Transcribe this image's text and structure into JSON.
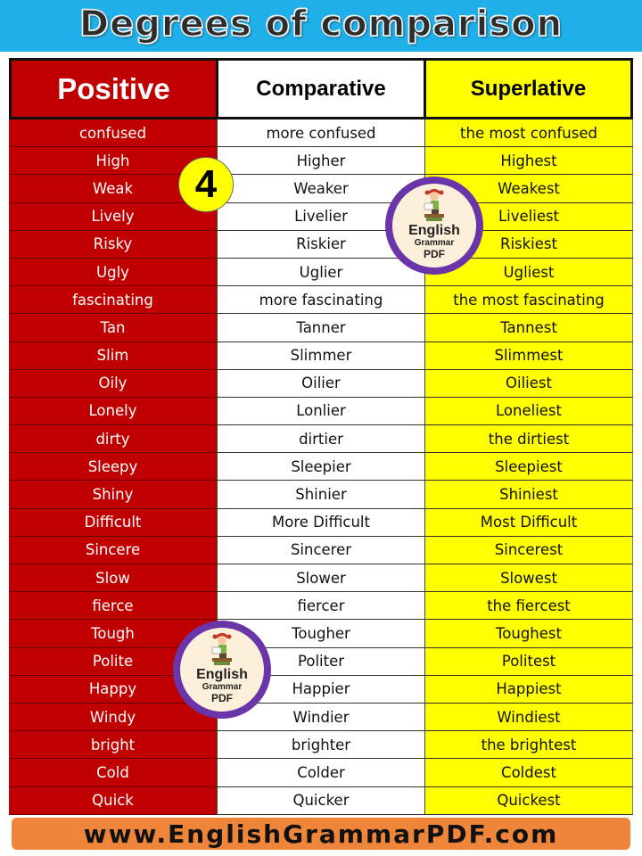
{
  "title": "Degrees of comparison",
  "headers": {
    "positive": "Positive",
    "comparative": "Comparative",
    "superlative": "Superlative"
  },
  "colors": {
    "banner": "#1fb0ea",
    "positive_bg": "#c00000",
    "comparative_bg": "#ffffff",
    "superlative_bg": "#ffff00",
    "footer_bg": "#ee8538",
    "logo_ring": "#6a35a8"
  },
  "badge_number": "4",
  "logo": {
    "line1": "English",
    "line2": "Grammar",
    "line3": "PDF",
    "icon": "girl-reading-books-icon"
  },
  "rows": [
    {
      "positive": "confused",
      "comparative": "more confused",
      "superlative": "the most confused"
    },
    {
      "positive": "High",
      "comparative": "Higher",
      "superlative": "Highest"
    },
    {
      "positive": "Weak",
      "comparative": "Weaker",
      "superlative": "Weakest"
    },
    {
      "positive": "Lively",
      "comparative": "Livelier",
      "superlative": "Liveliest"
    },
    {
      "positive": "Risky",
      "comparative": "Riskier",
      "superlative": "Riskiest"
    },
    {
      "positive": "Ugly",
      "comparative": "Uglier",
      "superlative": "Ugliest"
    },
    {
      "positive": "fascinating",
      "comparative": "more fascinating",
      "superlative": "the most fascinating"
    },
    {
      "positive": "Tan",
      "comparative": "Tanner",
      "superlative": "Tannest"
    },
    {
      "positive": "Slim",
      "comparative": "Slimmer",
      "superlative": "Slimmest"
    },
    {
      "positive": "Oily",
      "comparative": "Oilier",
      "superlative": "Oiliest"
    },
    {
      "positive": "Lonely",
      "comparative": "Lonlier",
      "superlative": "Loneliest"
    },
    {
      "positive": "dirty",
      "comparative": "dirtier",
      "superlative": "the dirtiest"
    },
    {
      "positive": "Sleepy",
      "comparative": "Sleepier",
      "superlative": "Sleepiest"
    },
    {
      "positive": "Shiny",
      "comparative": "Shinier",
      "superlative": "Shiniest"
    },
    {
      "positive": "Difficult",
      "comparative": "More Difficult",
      "superlative": "Most Difficult"
    },
    {
      "positive": "Sincere",
      "comparative": "Sincerer",
      "superlative": "Sincerest"
    },
    {
      "positive": "Slow",
      "comparative": "Slower",
      "superlative": "Slowest"
    },
    {
      "positive": "fierce",
      "comparative": "fiercer",
      "superlative": "the fiercest"
    },
    {
      "positive": "Tough",
      "comparative": "Tougher",
      "superlative": "Toughest"
    },
    {
      "positive": "Polite",
      "comparative": "Politer",
      "superlative": "Politest"
    },
    {
      "positive": "Happy",
      "comparative": "Happier",
      "superlative": "Happiest"
    },
    {
      "positive": "Windy",
      "comparative": "Windier",
      "superlative": "Windiest"
    },
    {
      "positive": "bright",
      "comparative": "brighter",
      "superlative": "the brightest"
    },
    {
      "positive": "Cold",
      "comparative": "Colder",
      "superlative": "Coldest"
    },
    {
      "positive": "Quick",
      "comparative": "Quicker",
      "superlative": "Quickest"
    }
  ],
  "footer": "www.EnglishGrammarPDF.com"
}
